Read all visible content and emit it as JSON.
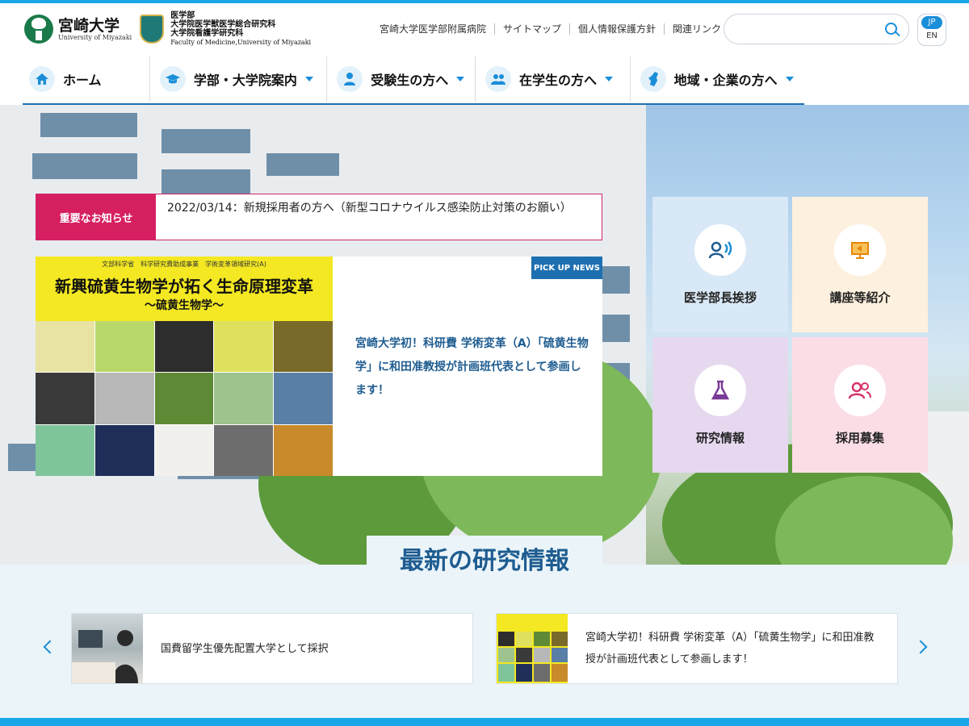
{
  "header": {
    "university_jp": "宮崎大学",
    "university_en": "University of Miyazaki",
    "faculty_lines": [
      "医学部",
      "大学院医学獣医学総合研究科",
      "大学院看護学研究科"
    ],
    "faculty_en": "Faculty of Medicine,University of Miyazaki",
    "utility_links": [
      "宮崎大学医学部附属病院",
      "サイトマップ",
      "個人情報保護方針",
      "関連リンク"
    ],
    "search_placeholder": "",
    "lang": {
      "jp": "JP",
      "en": "EN"
    }
  },
  "nav": [
    {
      "label": "ホーム",
      "icon": "home-icon",
      "dropdown": false
    },
    {
      "label": "学部・大学院案内",
      "icon": "graduation-cap-icon",
      "dropdown": true
    },
    {
      "label": "受験生の方へ",
      "icon": "student-icon",
      "dropdown": true
    },
    {
      "label": "在学生の方へ",
      "icon": "people-icon",
      "dropdown": true
    },
    {
      "label": "地域・企業の方へ",
      "icon": "map-icon",
      "dropdown": true
    }
  ],
  "notice": {
    "label": "重要なお知らせ",
    "text": "2022/03/14：新規採用者の方へ（新型コロナウイルス感染防止対策のお願い）"
  },
  "pickup": {
    "badge": "PICK UP NEWS",
    "image_top": "文部科学省　科学研究費助成事業　学術変革領域研究(A)",
    "image_title": "新興硫黄生物学が拓く生命原理変革",
    "image_subtitle": "〜硫黄生物学〜",
    "text": "宮崎大学初！科研費 学術変革（A）「硫黄生物学」に和田准教授が計画班代表として参画します！"
  },
  "tiles": [
    {
      "label": "医学部長挨拶",
      "icon": "speaker-icon",
      "bg": "#d9e8f6",
      "icon_color": "#1e5c90"
    },
    {
      "label": "講座等紹介",
      "icon": "presentation-icon",
      "bg": "#fdf0de",
      "icon_color": "#e8860b"
    },
    {
      "label": "研究情報",
      "icon": "flask-icon",
      "bg": "#e6d8ef",
      "icon_color": "#7a3b96"
    },
    {
      "label": "採用募集",
      "icon": "users-icon",
      "bg": "#fbdde6",
      "icon_color": "#d6336c"
    }
  ],
  "research": {
    "title": "最新の研究情報",
    "cards": [
      {
        "text": "国費留学生優先配置大学として採択"
      },
      {
        "text": "宮崎大学初！科研費 学術変革（A）「硫黄生物学」に和田准教授が計画班代表として参画します！"
      }
    ]
  },
  "colors": {
    "accent": "#1a8ed8",
    "notice": "#d61f61",
    "navy": "#1e5c90"
  }
}
